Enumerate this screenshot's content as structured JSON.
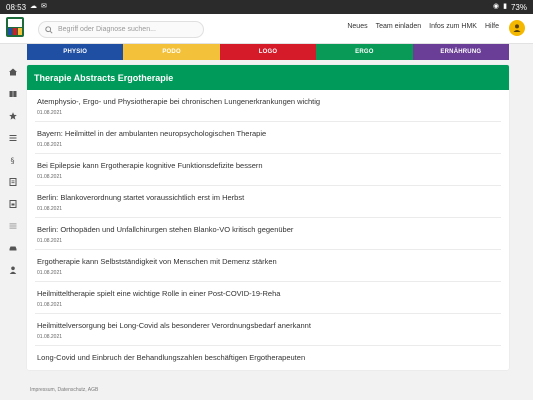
{
  "status_bar": {
    "time": "08:53",
    "battery": "73%"
  },
  "header": {
    "search_placeholder": "Begriff oder Diagnose suchen...",
    "links": [
      "Neues",
      "Team einladen",
      "Infos zum HMK",
      "Hilfe"
    ]
  },
  "tabs": [
    {
      "label": "PHYSIO",
      "color": "#1f4fa3"
    },
    {
      "label": "PODO",
      "color": "#f3c13a"
    },
    {
      "label": "LOGO",
      "color": "#d51a2a"
    },
    {
      "label": "ERGO",
      "color": "#0a9a58"
    },
    {
      "label": "ERNÄHRUNG",
      "color": "#6a3e96"
    }
  ],
  "panel": {
    "title": "Therapie Abstracts Ergotherapie",
    "items": [
      {
        "title": "Atemphysio-, Ergo- und Physiotherapie bei chronischen Lungenerkrankungen wichtig",
        "date": "01.08.2021"
      },
      {
        "title": "Bayern: Heilmittel in der ambulanten neuropsychologischen Therapie",
        "date": "01.08.2021"
      },
      {
        "title": "Bei Epilepsie kann Ergotherapie kognitive Funktionsdefizite bessern",
        "date": "01.08.2021"
      },
      {
        "title": "Berlin: Blankoverordnung startet voraussichtlich erst im Herbst",
        "date": "01.08.2021"
      },
      {
        "title": "Berlin: Orthopäden und Unfallchirurgen stehen Blanko-VO kritisch gegenüber",
        "date": "01.08.2021"
      },
      {
        "title": "Ergotherapie kann Selbstständigkeit von Menschen mit Demenz stärken",
        "date": "01.08.2021"
      },
      {
        "title": "Heilmitteltherapie spielt eine wichtige Rolle in einer Post-COVID-19-Reha",
        "date": "01.08.2021"
      },
      {
        "title": "Heilmittelversorgung bei Long-Covid als besonderer Verordnungsbedarf anerkannt",
        "date": "01.08.2021"
      },
      {
        "title": "Long-Covid und Einbruch der Behandlungszahlen beschäftigen Ergotherapeuten",
        "date": ""
      }
    ]
  },
  "footer": {
    "text": "Impressum, Datenschutz, AGB"
  },
  "colors": {
    "accent_green": "#009a5a",
    "avatar_yellow": "#f4b800"
  },
  "sidebar_icons": [
    "home-icon",
    "book-icon",
    "star-icon",
    "list-icon",
    "paragraph-icon",
    "document-icon",
    "form-icon",
    "menu-icon",
    "car-icon",
    "person-icon"
  ]
}
